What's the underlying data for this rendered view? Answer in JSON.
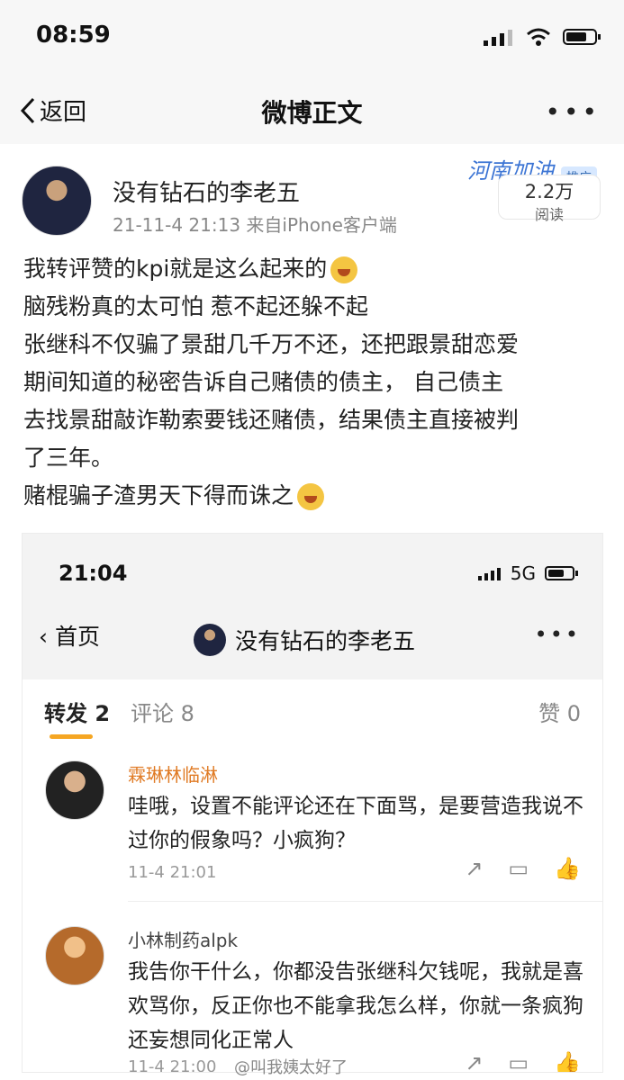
{
  "status": {
    "time": "08:59"
  },
  "nav": {
    "back_label": "返回",
    "title": "微博正文",
    "more": "•••"
  },
  "post": {
    "author": "没有钻石的李老五",
    "meta": "21-11-4 21:13  来自iPhone客户端",
    "promo": {
      "text": "河南加油",
      "tag": "推广",
      "reads": "2.2万",
      "read_label": "阅读"
    },
    "lines": [
      "我转评赞的kpi就是这么起来的",
      "脑残粉真的太可怕 惹不起还躲不起",
      "张继科不仅骗了景甜几千万不还，还把跟景甜恋爱",
      "期间知道的秘密告诉自己赌债的债主，  自己债主",
      "去找景甜敲诈勒索要钱还赌债，结果债主直接被判",
      "了三年。",
      "赌棍骗子渣男天下得而诛之"
    ]
  },
  "embedded": {
    "time": "21:04",
    "network": "5G",
    "back_label": "首页",
    "title": "没有钻石的李老五",
    "tabs": {
      "repost": "转发 2",
      "comments": "评论 8",
      "likes": "赞 0"
    },
    "comments": [
      {
        "name": "霖琳林临淋",
        "name_color": "#e07b25",
        "text": "哇哦，设置不能评论还在下面骂，是要营造我说不过你的假象吗？小疯狗？",
        "time": "11-4 21:01"
      },
      {
        "name": "小林制药alpk",
        "name_color": "#444444",
        "text": "我告你干什么，你都没告张继科欠钱呢，我就是喜欢骂你，反正你也不能拿我怎么样，你就一条疯狗还妄想同化正常人",
        "time": "11-4 21:00"
      }
    ]
  },
  "watermark": "@叫我姨太好了"
}
